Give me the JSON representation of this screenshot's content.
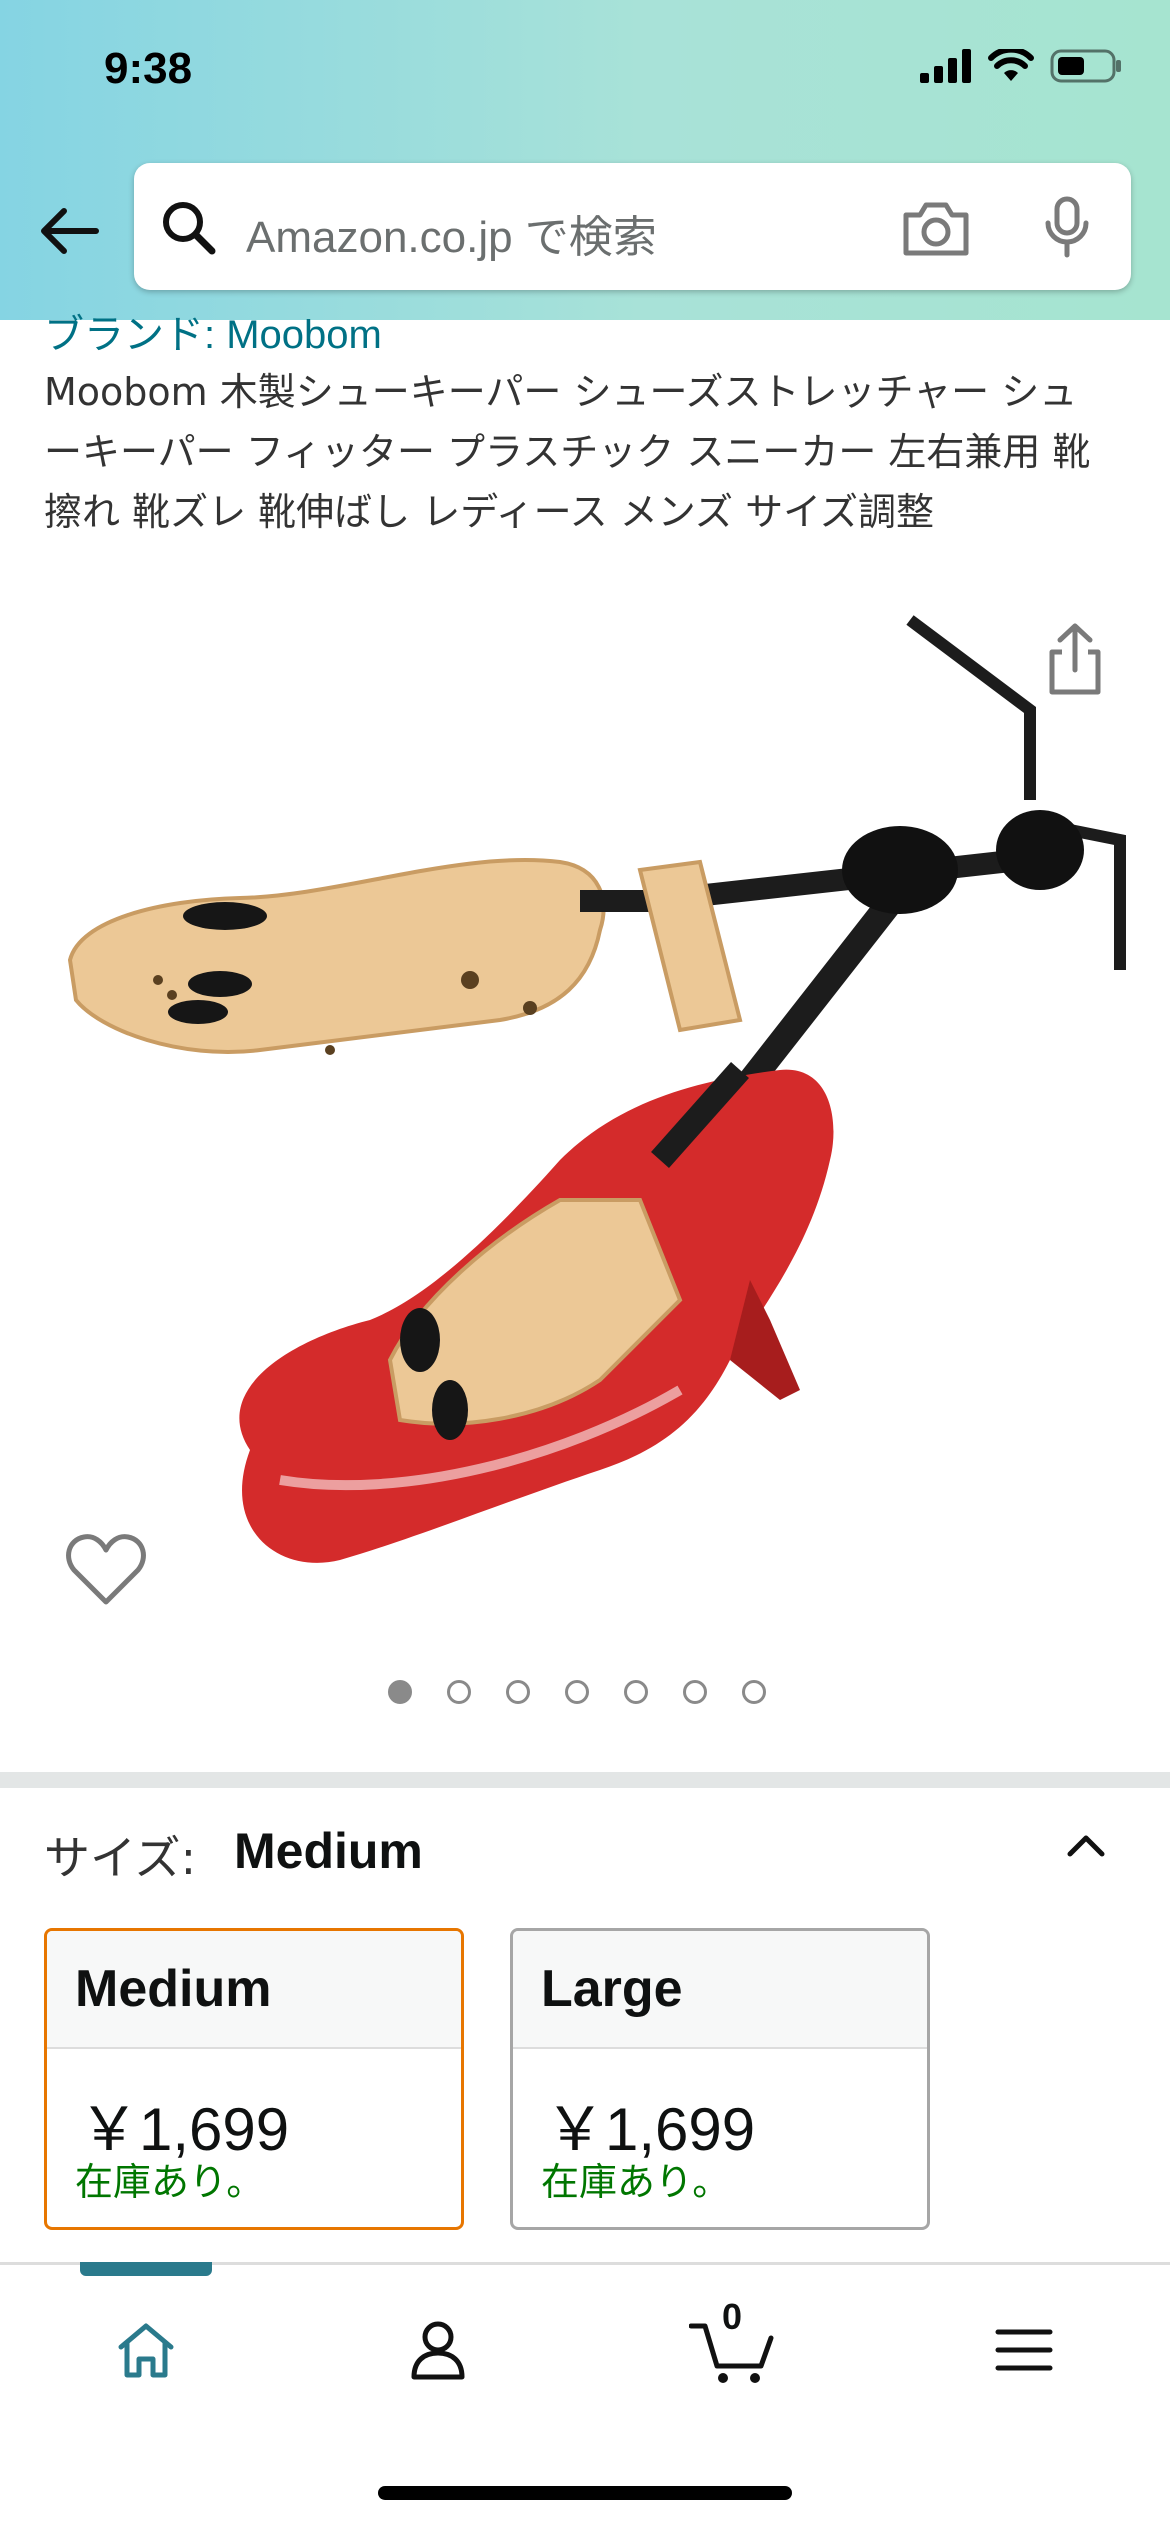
{
  "status_bar": {
    "time": "9:38"
  },
  "search": {
    "placeholder": "Amazon.co.jp で検索"
  },
  "product": {
    "brand": "ブランド: Moobom",
    "title": "Moobom 木製シューキーパー シューズストレッチャー シューキーパー フィッター プラスチック スニーカー 左右兼用 靴擦れ 靴ズレ 靴伸ばし レディース メンズ サイズ調整",
    "image_count": 7,
    "active_image_index": 0
  },
  "size_selector": {
    "label": "サイズ:",
    "selected": "Medium",
    "options": [
      {
        "name": "Medium",
        "price": "￥1,699",
        "stock": "在庫あり。"
      },
      {
        "name": "Large",
        "price": "￥1,699",
        "stock": "在庫あり。"
      }
    ]
  },
  "bottom_nav": {
    "cart_count": "0",
    "items": [
      "home-icon",
      "account-icon",
      "cart-icon",
      "menu-icon"
    ]
  },
  "colors": {
    "header_gradient_start": "#85d4e3",
    "header_gradient_end": "#a6e4d0",
    "link": "#007185",
    "selected_border": "#e77600",
    "in_stock": "#007600",
    "active_tab": "#2a7a8c"
  }
}
